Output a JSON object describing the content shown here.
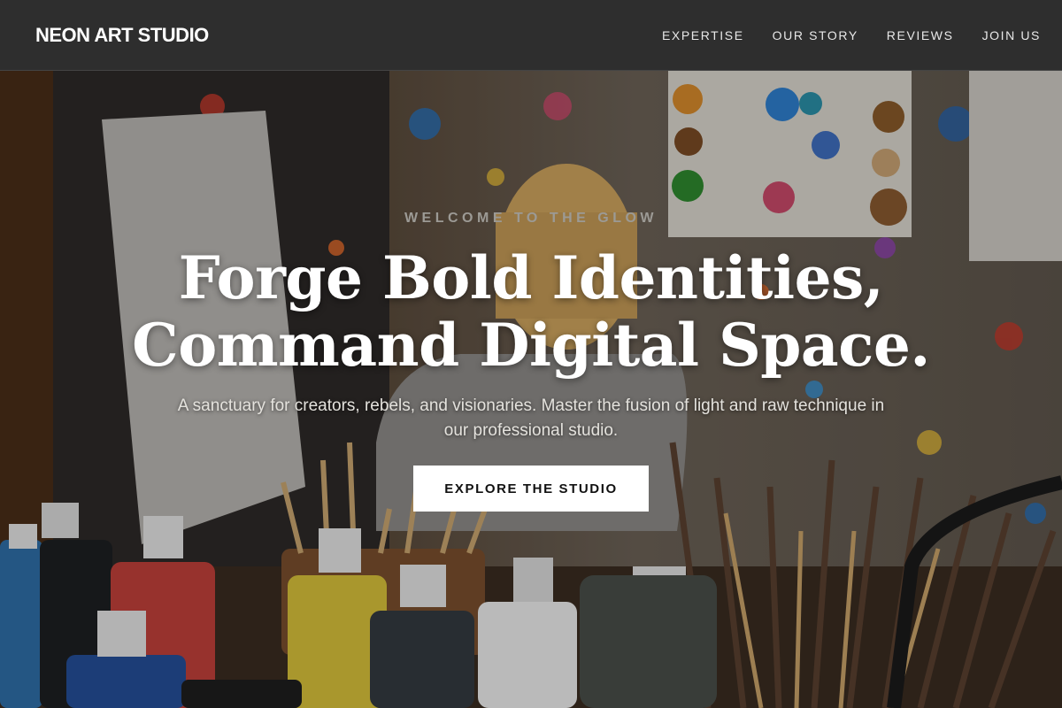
{
  "brand": {
    "name": "NEON ART STUDIO"
  },
  "nav": {
    "items": [
      {
        "label": "EXPERTISE"
      },
      {
        "label": "OUR STORY"
      },
      {
        "label": "REVIEWS"
      },
      {
        "label": "JOIN US"
      }
    ]
  },
  "hero": {
    "eyebrow": "WELCOME TO THE GLOW",
    "headline_line1": "Forge Bold Identities,",
    "headline_line2": "Command Digital Space.",
    "subtitle": "A sanctuary for creators, rebels, and visionaries. Master the fusion of light and raw technique in our professional studio.",
    "cta_label": "EXPLORE THE STUDIO"
  },
  "colors": {
    "header_bg": "#2e2e2e",
    "cta_bg": "#ffffff",
    "headline": "#ffffff",
    "eyebrow": "#9c9a95"
  }
}
